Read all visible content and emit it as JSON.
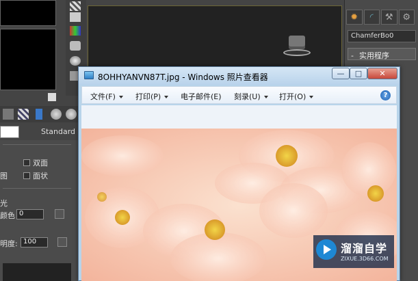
{
  "background_app": {
    "object_name": "ChamferBo0",
    "rollout_title": "实用程序",
    "side_labels": [
      "",
      "...",
      "...",
      "...",
      "...",
      "...",
      "...",
      "..."
    ],
    "material_type": "Standard",
    "checkbox_two_sided": "双面",
    "checkbox_faceted": "面状",
    "label_cut1": "图",
    "section_title": "光",
    "color_label": "颜色",
    "color_value": "0",
    "opacity_label": "明度:",
    "opacity_value": "100"
  },
  "viewer": {
    "title": "8OHHYANVN87T.jpg - Windows 照片查看器",
    "menu": [
      {
        "label": "文件(F)"
      },
      {
        "label": "打印(P)"
      },
      {
        "label": "电子邮件(E)"
      },
      {
        "label": "刻录(U)"
      },
      {
        "label": "打开(O)"
      }
    ],
    "help_glyph": "?",
    "min_glyph": "—",
    "max_glyph": "□",
    "close_glyph": "✕"
  },
  "watermark": {
    "text": "溜溜自学",
    "url": "ZIXUE.3D66.COM"
  },
  "colors": {
    "accent": "#1e88d4",
    "viewer_frame": "#b8d4ea"
  },
  "icons": {
    "help": "help-icon",
    "app": "photo-viewer-icon",
    "teapot": "teapot-icon"
  }
}
